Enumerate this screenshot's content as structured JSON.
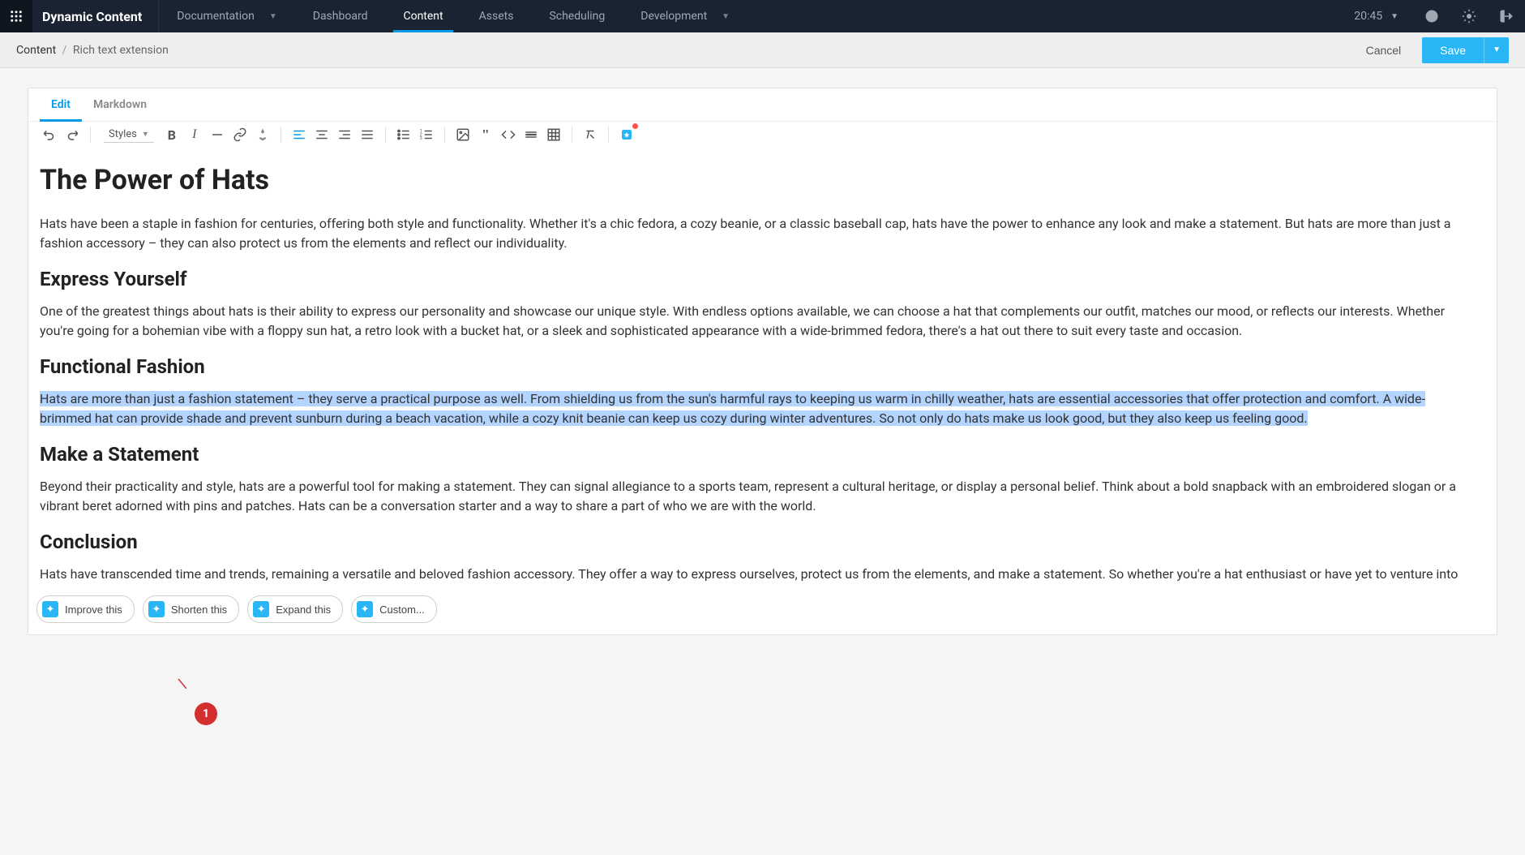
{
  "app": {
    "brand": "Dynamic Content",
    "time": "20:45"
  },
  "nav": {
    "items": [
      {
        "label": "Documentation",
        "caret": true
      },
      {
        "label": "Dashboard"
      },
      {
        "label": "Content",
        "active": true
      },
      {
        "label": "Assets"
      },
      {
        "label": "Scheduling"
      },
      {
        "label": "Development",
        "caret": true
      }
    ]
  },
  "breadcrumb": {
    "root": "Content",
    "separator": "/",
    "current": "Rich text extension"
  },
  "subbar": {
    "cancel_label": "Cancel",
    "save_label": "Save"
  },
  "editor_tabs": {
    "edit": "Edit",
    "markdown": "Markdown"
  },
  "toolbar": {
    "styles_label": "Styles"
  },
  "document": {
    "h1": "The Power of Hats",
    "p1": "Hats have been a staple in fashion for centuries, offering both style and functionality. Whether it's a chic fedora, a cozy beanie, or a classic baseball cap, hats have the power to enhance any look and make a statement. But hats are more than just a fashion accessory – they can also protect us from the elements and reflect our individuality.",
    "h2_1": "Express Yourself",
    "p2": "One of the greatest things about hats is their ability to express our personality and showcase our unique style. With endless options available, we can choose a hat that complements our outfit, matches our mood, or reflects our interests. Whether you're going for a bohemian vibe with a floppy sun hat, a retro look with a bucket hat, or a sleek and sophisticated appearance with a wide-brimmed fedora, there's a hat out there to suit every taste and occasion.",
    "h2_2": "Functional Fashion",
    "p3": "Hats are more than just a fashion statement – they serve a practical purpose as well. From shielding us from the sun's harmful rays to keeping us warm in chilly weather, hats are essential accessories that offer protection and comfort. A wide-brimmed hat can provide shade and prevent sunburn during a beach vacation, while a cozy knit beanie can keep us cozy during winter adventures. So not only do hats make us look good, but they also keep us feeling good.",
    "h2_3": "Make a Statement",
    "p4": "Beyond their practicality and style, hats are a powerful tool for making a statement. They can signal allegiance to a sports team, represent a cultural heritage, or display a personal belief. Think about a bold snapback with an embroidered slogan or a vibrant beret adorned with pins and patches. Hats can be a conversation starter and a way to share a part of who we are with the world.",
    "h2_4": "Conclusion",
    "p5": "Hats have transcended time and trends, remaining a versatile and beloved fashion accessory. They offer a way to express ourselves, protect us from the elements, and make a statement. So whether you're a hat enthusiast or have yet to venture into the world of headwear, it's time to embrace the power of hats and let them be an extension of your personal style."
  },
  "ai_actions": {
    "improve": "Improve this",
    "shorten": "Shorten this",
    "expand": "Expand this",
    "custom": "Custom..."
  },
  "annotation": {
    "badge": "1"
  }
}
